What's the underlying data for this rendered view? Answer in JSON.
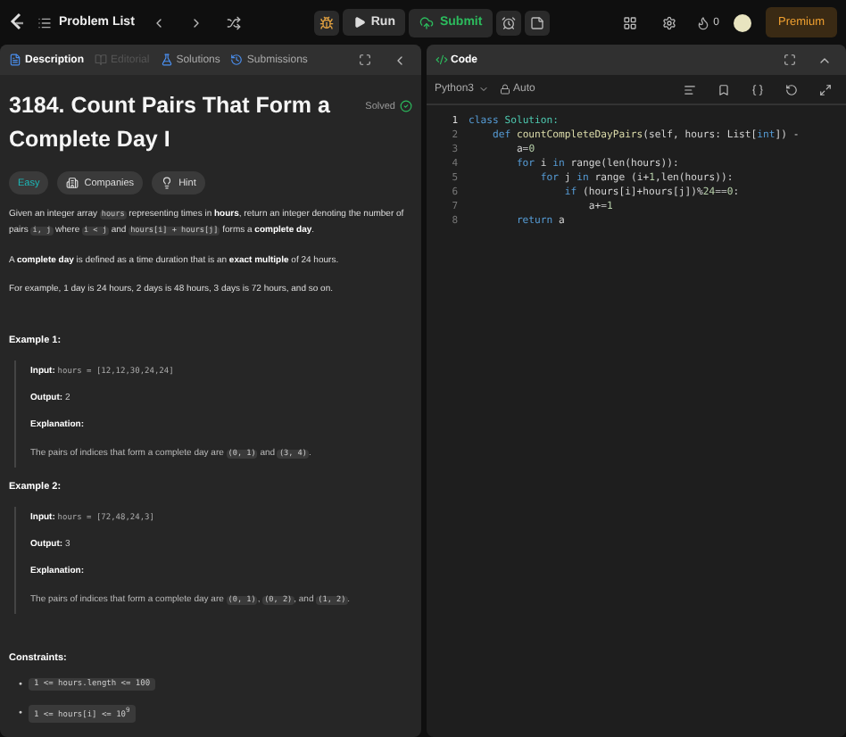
{
  "topbar": {
    "nav_title": "Problem List",
    "run": "Run",
    "submit": "Submit",
    "streak": "0",
    "premium": "Premium"
  },
  "left_tabs": [
    {
      "label": "Description",
      "selected": true,
      "disabled": false
    },
    {
      "label": "Editorial",
      "selected": false,
      "disabled": true
    },
    {
      "label": "Solutions",
      "selected": false,
      "disabled": false
    },
    {
      "label": "Submissions",
      "selected": false,
      "disabled": false
    }
  ],
  "problem": {
    "title": "3184. Count Pairs That Form a Complete Day I",
    "status": "Solved",
    "difficulty": "Easy",
    "tags": [
      "Companies",
      "Hint"
    ],
    "paragraphs": [
      [
        {
          "kind": "text",
          "text": "Given an integer array "
        },
        {
          "kind": "code",
          "text": "hours"
        },
        {
          "kind": "text",
          "text": " representing times in **hours**, return an integer denoting the number of pairs "
        },
        {
          "kind": "code",
          "text": "i, j"
        },
        {
          "kind": "text",
          "text": " where "
        },
        {
          "kind": "code",
          "text": "i < j"
        },
        {
          "kind": "text",
          "text": " and "
        },
        {
          "kind": "code",
          "text": "hours[i] + hours[j]"
        },
        {
          "kind": "text",
          "text": " forms a **complete day**."
        }
      ],
      [
        {
          "kind": "text",
          "text": "A **complete day** is defined as a time duration that is an **exact multiple** of 24 hours."
        }
      ],
      [
        {
          "kind": "text",
          "text": "For example, 1 day is 24 hours, 2 days is 48 hours, 3 days is 72 hours, and so on."
        }
      ]
    ],
    "examples": [
      {
        "title": "Example 1:",
        "input_label": "Input:",
        "input": "hours = [12,12,30,24,24]",
        "output_label": "Output:",
        "output": "2",
        "explanation_label": "Explanation:",
        "explanation": [
          {
            "kind": "text",
            "text": "The pairs of indices that form a complete day are "
          },
          {
            "kind": "code",
            "text": "(0, 1)"
          },
          {
            "kind": "text",
            "text": " and "
          },
          {
            "kind": "code",
            "text": "(3, 4)"
          },
          {
            "kind": "text",
            "text": "."
          }
        ]
      },
      {
        "title": "Example 2:",
        "input_label": "Input:",
        "input": "hours = [72,48,24,3]",
        "output_label": "Output:",
        "output": "3",
        "explanation_label": "Explanation:",
        "explanation": [
          {
            "kind": "text",
            "text": "The pairs of indices that form a complete day are "
          },
          {
            "kind": "code",
            "text": "(0, 1)"
          },
          {
            "kind": "text",
            "text": ", "
          },
          {
            "kind": "code",
            "text": "(0, 2)"
          },
          {
            "kind": "text",
            "text": ", and "
          },
          {
            "kind": "code",
            "text": "(1, 2)"
          },
          {
            "kind": "text",
            "text": "."
          }
        ]
      }
    ],
    "constraints_title": "Constraints:",
    "constraints": [
      {
        "marker": "•",
        "text": "1 <= hours.length <= 100"
      },
      {
        "marker": "•",
        "text": "1 <= hours[i] <= 10$^{9}$"
      }
    ]
  },
  "code_panel": {
    "title": "Code",
    "language": "Python3",
    "mode": "Auto",
    "lines": [
      {
        "number": "1",
        "tokens": [
          {
            "kind": "kw",
            "text": "class"
          },
          {
            "kind": "cls",
            "text": " Solution:"
          }
        ]
      },
      {
        "number": "2",
        "tokens": [
          {
            "kind": "kw",
            "text": "    def"
          },
          {
            "kind": "fn",
            "text": " countCompleteDayPairs"
          },
          {
            "kind": "plain",
            "text": "(self, hours: List["
          },
          {
            "kind": "kw",
            "text": "int"
          },
          {
            "kind": "plain",
            "text": "]) -"
          }
        ]
      },
      {
        "number": "3",
        "tokens": [
          {
            "kind": "plain",
            "text": "        a="
          },
          {
            "kind": "num",
            "text": "0"
          }
        ]
      },
      {
        "number": "4",
        "tokens": [
          {
            "kind": "kw",
            "text": "        for"
          },
          {
            "kind": "plain",
            "text": " i "
          },
          {
            "kind": "kw",
            "text": "in"
          },
          {
            "kind": "plain",
            "text": " range(len(hours)):"
          }
        ]
      },
      {
        "number": "5",
        "tokens": [
          {
            "kind": "kw",
            "text": "            for"
          },
          {
            "kind": "plain",
            "text": " j "
          },
          {
            "kind": "kw",
            "text": "in"
          },
          {
            "kind": "plain",
            "text": " range (i+"
          },
          {
            "kind": "num",
            "text": "1"
          },
          {
            "kind": "plain",
            "text": ",len(hours)):"
          }
        ]
      },
      {
        "number": "6",
        "tokens": [
          {
            "kind": "kw",
            "text": "                if"
          },
          {
            "kind": "plain",
            "text": " (hours[i]+hours[j])%"
          },
          {
            "kind": "num",
            "text": "24"
          },
          {
            "kind": "plain",
            "text": "=="
          },
          {
            "kind": "num",
            "text": "0"
          },
          {
            "kind": "plain",
            "text": ":"
          }
        ]
      },
      {
        "number": "7",
        "tokens": [
          {
            "kind": "plain",
            "text": "                    a+="
          },
          {
            "kind": "num",
            "text": "1"
          }
        ]
      },
      {
        "number": "8",
        "tokens": [
          {
            "kind": "kw",
            "text": "        return"
          },
          {
            "kind": "plain",
            "text": " a"
          }
        ]
      }
    ]
  }
}
